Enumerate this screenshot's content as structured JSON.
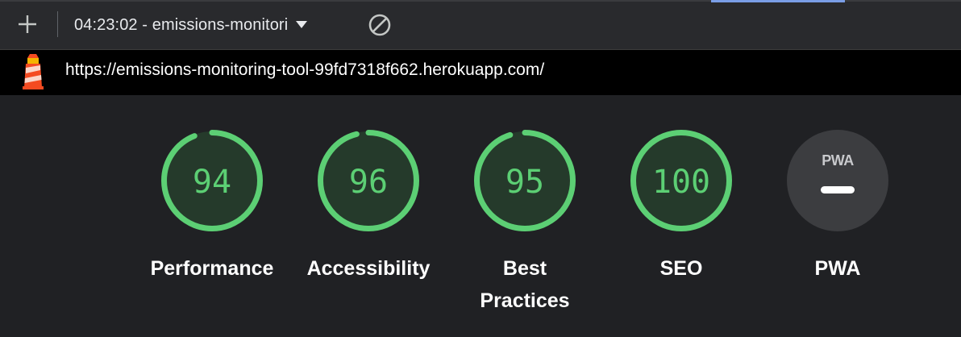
{
  "toolbar": {
    "new_report_icon": "plus-icon",
    "report_selector_label": "04:23:02 - emissions-monitori",
    "clear_icon": "block-icon"
  },
  "url_bar": {
    "logo_icon": "lighthouse-icon",
    "url": "https://emissions-monitoring-tool-99fd7318f662.herokuapp.com/"
  },
  "colors": {
    "pass_green": "#5ccf74",
    "pwa_gray": "#3c3d40",
    "background": "#202124"
  },
  "categories": [
    {
      "label": "Performance",
      "score": "94",
      "fraction": 0.94
    },
    {
      "label": "Accessibility",
      "score": "96",
      "fraction": 0.96
    },
    {
      "label": "Best\nPractices",
      "score": "95",
      "fraction": 0.95
    },
    {
      "label": "SEO",
      "score": "100",
      "fraction": 1.0
    }
  ],
  "pwa": {
    "label": "PWA",
    "badge_text": "PWA",
    "state": "not-applicable"
  }
}
